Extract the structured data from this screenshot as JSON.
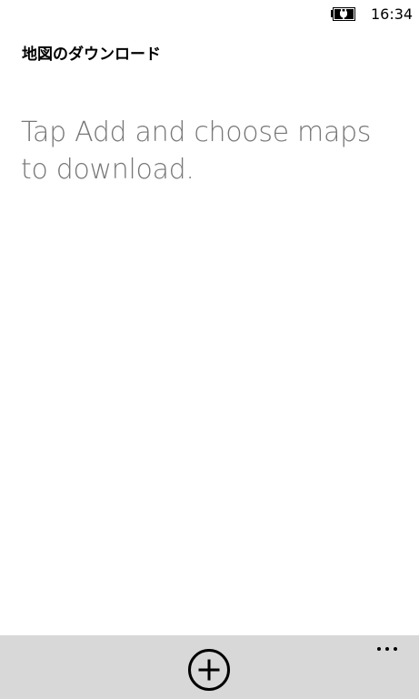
{
  "status_bar": {
    "time": "16:34",
    "battery_icon": "battery-charging-icon"
  },
  "header": {
    "title": "地図のダウンロード"
  },
  "main": {
    "empty_message": "Tap Add and choose maps to download."
  },
  "app_bar": {
    "add_icon": "add-circle-icon",
    "more_icon": "more-ellipsis-icon",
    "background_color": "#d8d8d8"
  }
}
